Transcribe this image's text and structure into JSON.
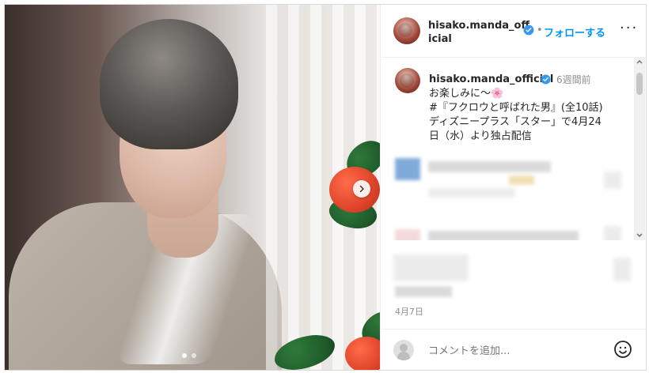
{
  "post": {
    "handle": "hisako.manda_official",
    "header_handle_line1": "hisako.manda_off",
    "header_handle_line2": "icial",
    "follow_separator": "•",
    "follow_label": "フォローする",
    "more_label": "···"
  },
  "caption": {
    "handle": "hisako.manda_official",
    "time_ago": "6週間前",
    "text": "お楽しみに〜🌸\n#『フクロウと呼ばれた男』(全10話)\nディズニープラス「スター」で4月24\n日（水）より独占配信"
  },
  "meta": {
    "date": "4月7日"
  },
  "comment": {
    "placeholder": "コメントを追加..."
  },
  "icons": {
    "next": "chevron-right-icon",
    "verified": "verified-badge-icon",
    "more": "more-horizontal-icon",
    "emoji": "emoji-icon",
    "scroll_up": "scroll-up-icon",
    "scroll_down": "scroll-down-icon"
  },
  "colors": {
    "accent": "#0095f6",
    "text": "#262626",
    "muted": "#8e8e8e",
    "border": "#dbdbdb"
  }
}
